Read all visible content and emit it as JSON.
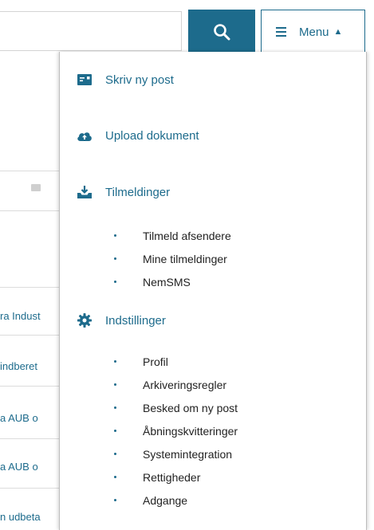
{
  "header": {
    "search_placeholder": "",
    "menu_label": "Menu",
    "menu_arrow": "▲"
  },
  "background": {
    "links": [
      "ra Indust",
      " indberet",
      "a AUB o",
      "a AUB o",
      "n udbeta"
    ]
  },
  "menu": {
    "items": [
      {
        "label": "Skriv ny post",
        "icon": "envelope-icon"
      },
      {
        "label": "Upload dokument",
        "icon": "cloud-upload-icon"
      },
      {
        "label": "Tilmeldinger",
        "icon": "inbox-download-icon",
        "subitems": [
          "Tilmeld afsendere",
          "Mine tilmeldinger",
          "NemSMS"
        ]
      },
      {
        "label": "Indstillinger",
        "icon": "gear-icon",
        "subitems": [
          "Profil",
          "Arkiveringsregler",
          "Besked om ny post",
          "Åbningskvitteringer",
          "Systemintegration",
          "Rettigheder",
          "Adgange"
        ]
      }
    ]
  },
  "colors": {
    "accent": "#1d6b8c"
  }
}
